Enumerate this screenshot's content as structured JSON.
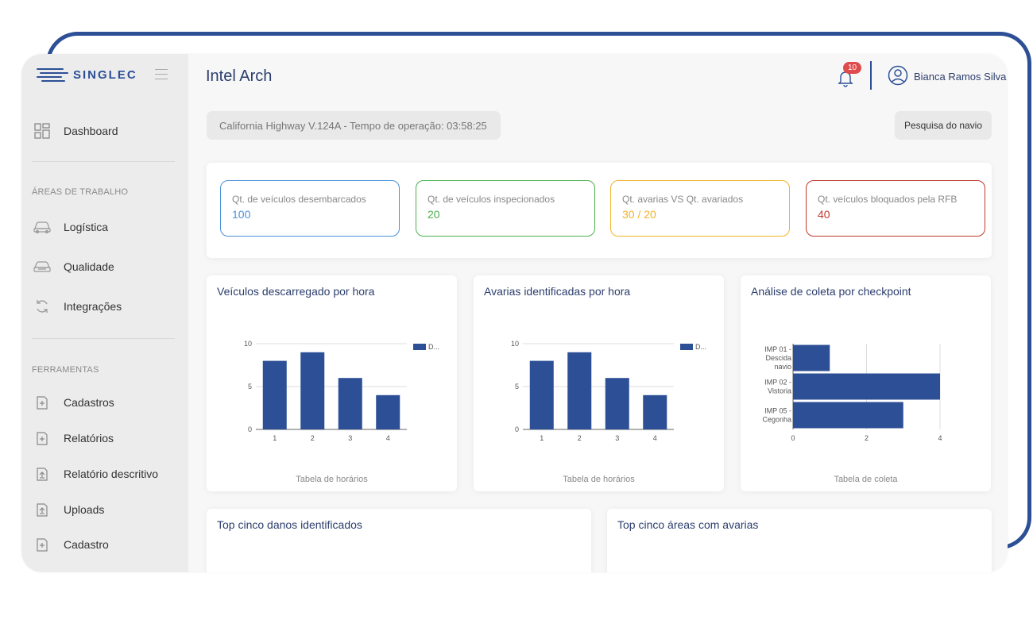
{
  "brand": {
    "name": "SINGLEC"
  },
  "sidebar": {
    "dashboard": "Dashboard",
    "section_work": "ÁREAS DE TRABALHO",
    "work_items": [
      "Logística",
      "Qualidade",
      "Integrações"
    ],
    "section_tools": "FERRAMENTAS",
    "tool_items": [
      "Cadastros",
      "Relatórios",
      "Relatório descritivo",
      "Uploads",
      "Cadastro"
    ]
  },
  "header": {
    "title": "Intel Arch",
    "notifications_count": "10",
    "user_name": "Bianca Ramos Silva"
  },
  "info_bar": {
    "text": "California Highway V.124A - Tempo de operação: 03:58:25",
    "search_button": "Pesquisa do navio"
  },
  "kpis": [
    {
      "label": "Qt. de veículos desembarcados",
      "value": "100",
      "color": "#4a90d9"
    },
    {
      "label": "Qt. de veículos inspecionados",
      "value": "20",
      "color": "#4caf50"
    },
    {
      "label": "Qt. avarias VS Qt. avariados",
      "value": "30 / 20",
      "color": "#f0b429"
    },
    {
      "label": "Qt. veículos bloquados pela RFB",
      "value": "40",
      "color": "#c0392b"
    }
  ],
  "cards": {
    "unloaded": {
      "title": "Veículos descarregado por hora",
      "footer": "Tabela de horários"
    },
    "damages": {
      "title": "Avarias identificadas por hora",
      "footer": "Tabela de horários"
    },
    "checkpoint": {
      "title": "Análise de coleta por checkpoint",
      "footer": "Tabela de coleta"
    },
    "top_damages": {
      "title": "Top cinco danos identificados"
    },
    "top_areas": {
      "title": "Top cinco áreas com avarias"
    }
  },
  "chart_data": [
    {
      "type": "bar",
      "categories": [
        "1",
        "2",
        "3",
        "4"
      ],
      "series": [
        {
          "name": "D...",
          "values": [
            8,
            9,
            6,
            4
          ]
        }
      ],
      "xlabel": "Tabela de horários",
      "ylim": [
        0,
        10
      ],
      "yticks": [
        0,
        5,
        10
      ],
      "legend": "top-right",
      "color": "#2c4f96"
    },
    {
      "type": "bar",
      "categories": [
        "1",
        "2",
        "3",
        "4"
      ],
      "series": [
        {
          "name": "D...",
          "values": [
            8,
            9,
            6,
            4
          ]
        }
      ],
      "xlabel": "Tabela de horários",
      "ylim": [
        0,
        10
      ],
      "yticks": [
        0,
        5,
        10
      ],
      "legend": "top-right",
      "color": "#2c4f96"
    },
    {
      "type": "bar",
      "orientation": "horizontal",
      "categories": [
        "IMP 01 - Descida navio",
        "IMP 02 - Vistoria",
        "IMP 05 - Cegonha"
      ],
      "category_lines": [
        [
          "IMP 01 -",
          "Descida",
          "navio"
        ],
        [
          "IMP 02 -",
          "Vistoria"
        ],
        [
          "IMP 05 -",
          "Cegonha"
        ]
      ],
      "values": [
        1,
        4,
        3
      ],
      "xlabel": "Tabela de coleta",
      "xlim": [
        0,
        4
      ],
      "xticks": [
        0,
        2,
        4
      ],
      "color": "#2c4f96"
    }
  ]
}
